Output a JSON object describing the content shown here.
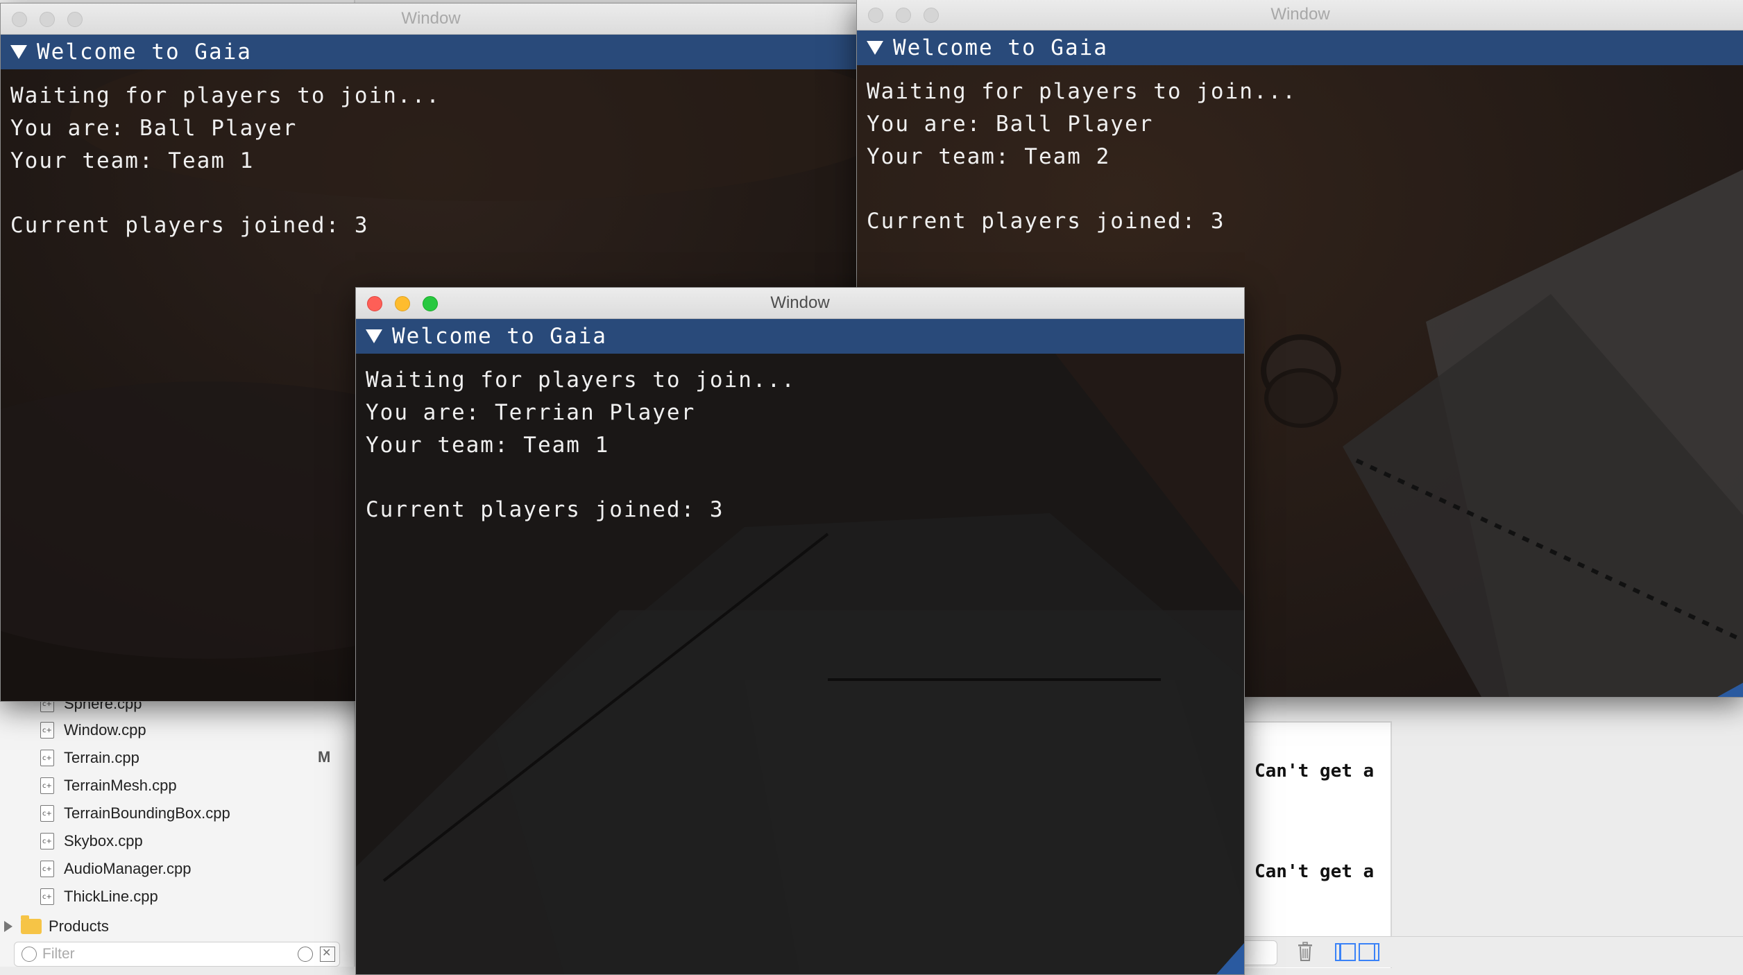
{
  "ide": {
    "files": [
      {
        "name": "Sphere.cpp",
        "status": ""
      },
      {
        "name": "Window.cpp",
        "status": ""
      },
      {
        "name": "Terrain.cpp",
        "status": "M"
      },
      {
        "name": "TerrainMesh.cpp",
        "status": ""
      },
      {
        "name": "TerrainBoundingBox.cpp",
        "status": ""
      },
      {
        "name": "Skybox.cpp",
        "status": ""
      },
      {
        "name": "AudioManager.cpp",
        "status": ""
      },
      {
        "name": "ThickLine.cpp",
        "status": ""
      }
    ],
    "products_label": "Products",
    "filter_placeholder": "Filter",
    "console_lines": [
      "Can't get a",
      "Can't get a"
    ]
  },
  "windows": [
    {
      "title": "Window",
      "header": "Welcome to Gaia",
      "waiting": "Waiting for players to join...",
      "you_are": "You are: Ball Player",
      "team": "Your team: Team 1",
      "joined": "Current players joined: 3"
    },
    {
      "title": "Window",
      "header": "Welcome to Gaia",
      "waiting": "Waiting for players to join...",
      "you_are": "You are: Ball Player",
      "team": "Your team: Team 2",
      "joined": "Current players joined: 3"
    },
    {
      "title": "Window",
      "header": "Welcome to Gaia",
      "waiting": "Waiting for players to join...",
      "you_are": "You are: Terrian Player",
      "team": "Your team: Team 1",
      "joined": "Current players joined: 3"
    }
  ],
  "colors": {
    "imgui_header": "#294a7a",
    "scene_dark": "#1a1412",
    "close": "#fe5f57",
    "minimize": "#febc2e",
    "maximize": "#28c840"
  }
}
